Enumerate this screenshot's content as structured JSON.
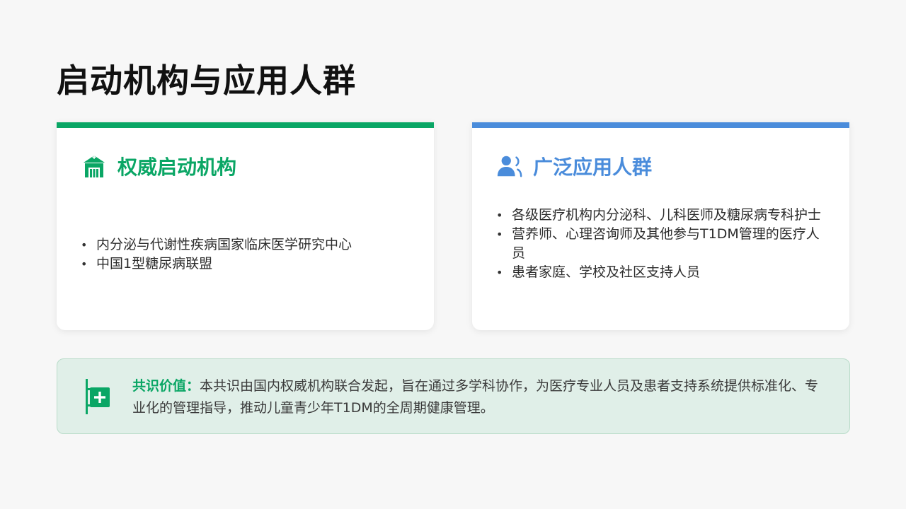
{
  "slide": {
    "title": "启动机构与应用人群"
  },
  "cards": {
    "left": {
      "title": "权威启动机构",
      "icon": "hospital-icon",
      "accent": "#0aa665",
      "items": [
        "内分泌与代谢性疾病国家临床医学研究中心",
        "中国1型糖尿病联盟"
      ]
    },
    "right": {
      "title": "广泛应用人群",
      "icon": "users-icon",
      "accent": "#4a8cdb",
      "items": [
        "各级医疗机构内分泌科、儿科医师及糖尿病专科护士",
        "营养师、心理咨询师及其他参与T1DM管理的医疗人员",
        "患者家庭、学校及社区支持人员"
      ]
    }
  },
  "banner": {
    "icon": "medical-plus-icon",
    "label": "共识价值：",
    "text": "本共识由国内权威机构联合发起，旨在通过多学科协作，为医疗专业人员及患者支持系统提供标准化、专业化的管理指导，推动儿童青少年T1DM的全周期健康管理。",
    "background": "#e0efe8"
  }
}
